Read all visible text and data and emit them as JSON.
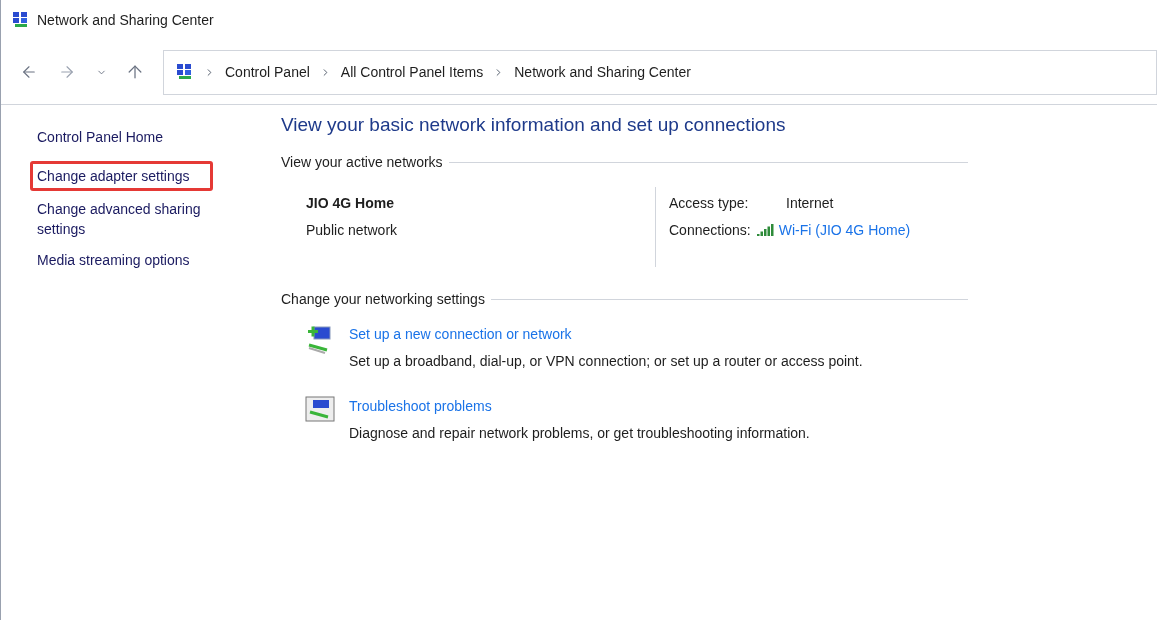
{
  "window": {
    "title": "Network and Sharing Center"
  },
  "breadcrumb": [
    "Control Panel",
    "All Control Panel Items",
    "Network and Sharing Center"
  ],
  "sidebar": {
    "items": [
      {
        "label": "Control Panel Home",
        "highlighted": false
      },
      {
        "label": "Change adapter settings",
        "highlighted": true
      },
      {
        "label": "Change advanced sharing settings",
        "highlighted": false
      },
      {
        "label": "Media streaming options",
        "highlighted": false
      }
    ]
  },
  "main": {
    "heading": "View your basic network information and set up connections",
    "active_networks": {
      "title": "View your active networks",
      "name": "JIO 4G Home",
      "category": "Public network",
      "access_type_label": "Access type:",
      "access_type": "Internet",
      "connections_label": "Connections:",
      "connection": "Wi-Fi (JIO 4G Home)"
    },
    "settings": {
      "title": "Change your networking settings",
      "tasks": [
        {
          "kind": "new-connection",
          "link": "Set up a new connection or network",
          "description": "Set up a broadband, dial-up, or VPN connection; or set up a router or access point."
        },
        {
          "kind": "troubleshoot",
          "link": "Troubleshoot problems",
          "description": "Diagnose and repair network problems, or get troubleshooting information."
        }
      ]
    }
  }
}
